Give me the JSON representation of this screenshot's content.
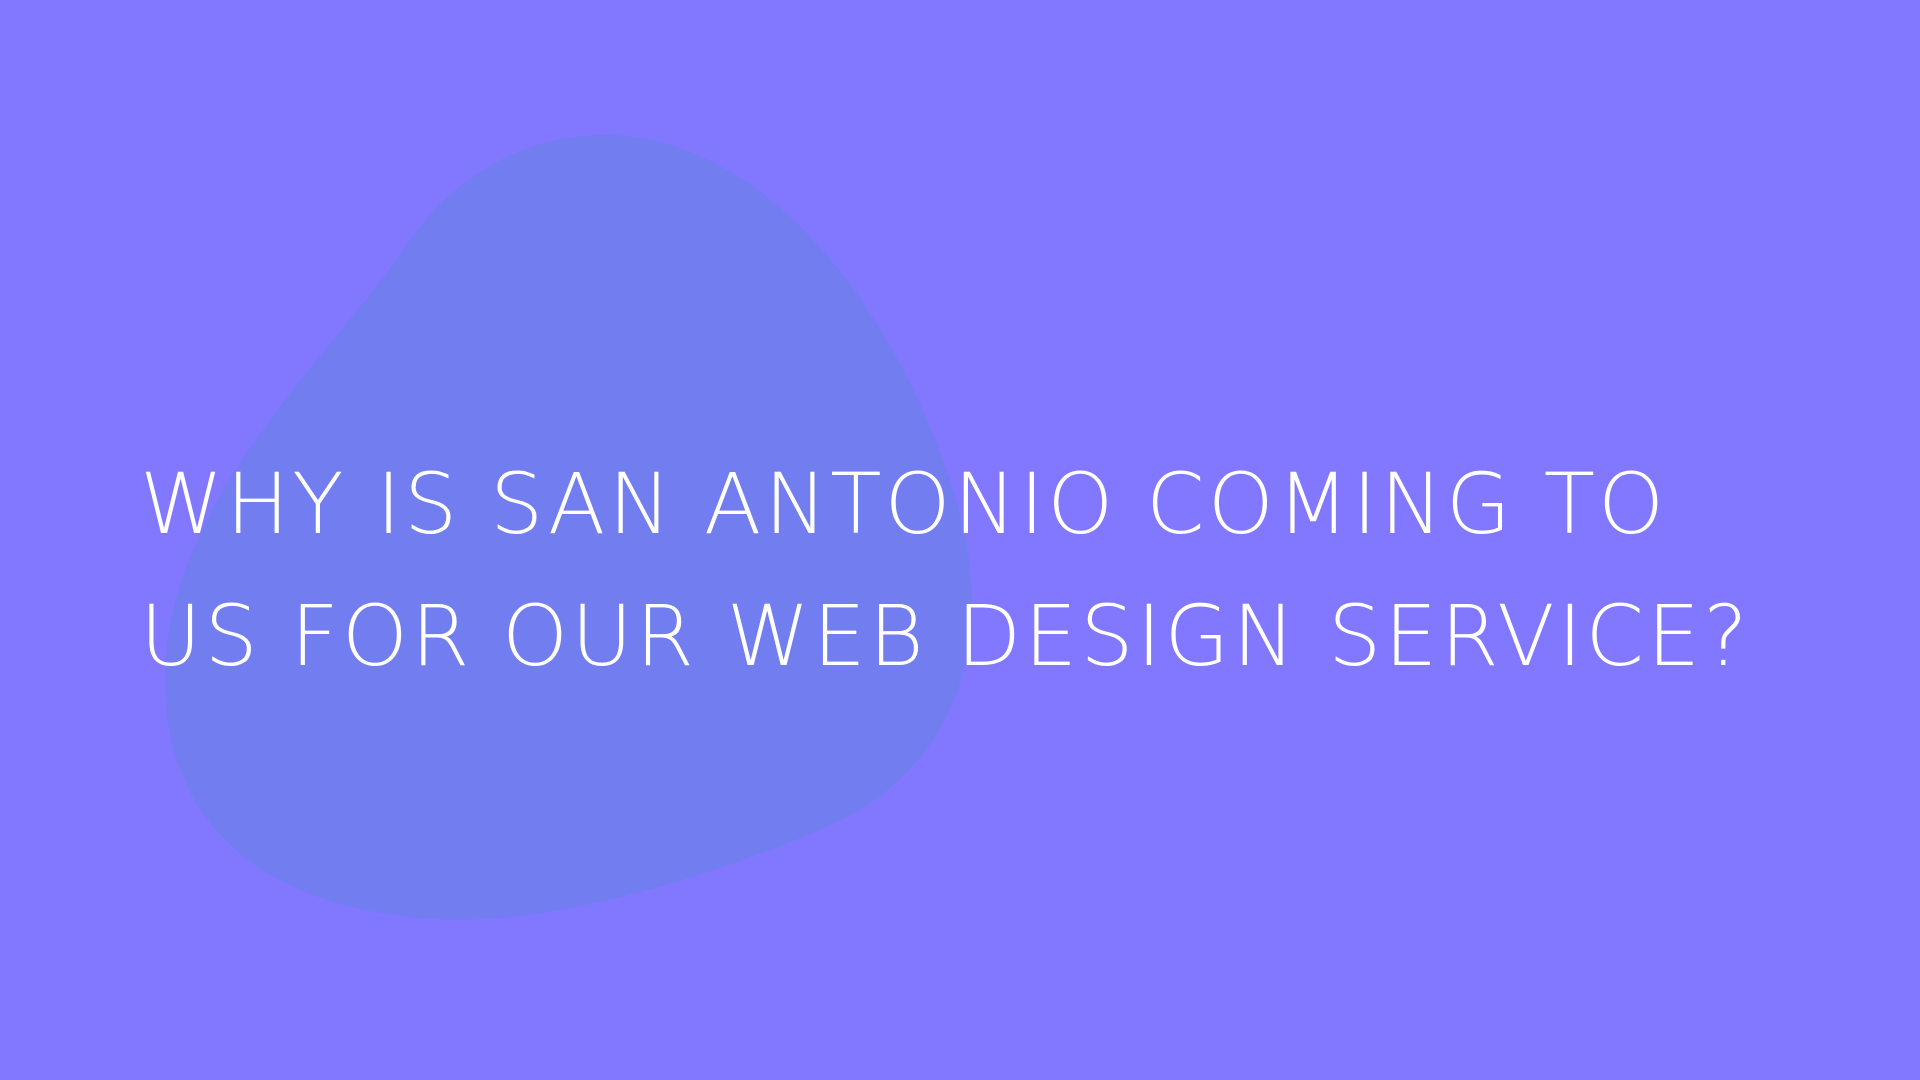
{
  "colors": {
    "background": "#8178FF",
    "blob": "#727DF0",
    "text": "#FFFFFF"
  },
  "headline": {
    "line1": "WHY IS SAN ANTONIO COMING TO",
    "line2": "US FOR OUR WEB DESIGN SERVICE?"
  }
}
